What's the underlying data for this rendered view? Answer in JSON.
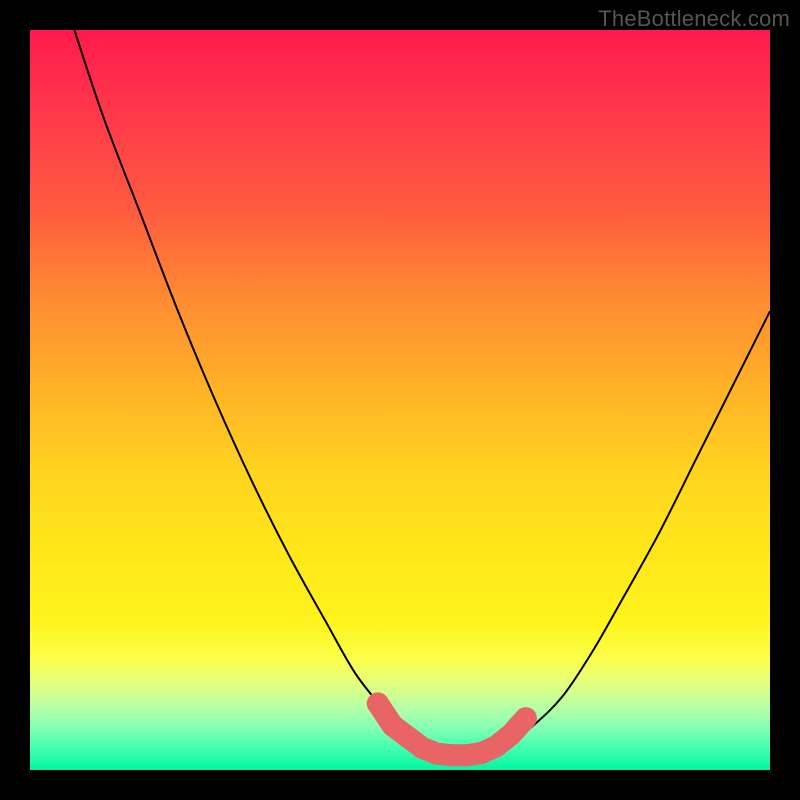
{
  "watermark": "TheBottleneck.com",
  "chart_data": {
    "type": "line",
    "title": "",
    "xlabel": "",
    "ylabel": "",
    "xlim": [
      0,
      100
    ],
    "ylim": [
      0,
      100
    ],
    "grid": false,
    "legend": false,
    "series": [
      {
        "name": "bottleneck-curve",
        "x": [
          6,
          10,
          15,
          20,
          25,
          30,
          35,
          40,
          44,
          48,
          51,
          54,
          58,
          60,
          64,
          68,
          72,
          76,
          80,
          85,
          90,
          95,
          100
        ],
        "y": [
          100,
          88,
          75,
          62,
          50,
          39,
          29,
          20,
          13,
          8,
          5,
          3,
          2,
          2,
          3,
          6,
          10,
          16,
          23,
          32,
          42,
          52,
          62
        ]
      }
    ],
    "highlight_points": {
      "name": "optimal-range-markers",
      "x": [
        47,
        49,
        51,
        53,
        55,
        57,
        59,
        61,
        63,
        65,
        67
      ],
      "y": [
        9,
        6,
        4.5,
        3,
        2.2,
        2,
        2,
        2.3,
        3.2,
        4.8,
        7
      ]
    },
    "gradient_stops": [
      {
        "pos": 0,
        "color": "#ff1a4d"
      },
      {
        "pos": 12,
        "color": "#ff3a4a"
      },
      {
        "pos": 24,
        "color": "#ff5a3f"
      },
      {
        "pos": 36,
        "color": "#ff8a33"
      },
      {
        "pos": 48,
        "color": "#ffb028"
      },
      {
        "pos": 60,
        "color": "#ffd41f"
      },
      {
        "pos": 70,
        "color": "#ffe61a"
      },
      {
        "pos": 80,
        "color": "#fff41c"
      },
      {
        "pos": 85,
        "color": "#fbff4a"
      },
      {
        "pos": 88,
        "color": "#e6ff7a"
      },
      {
        "pos": 91,
        "color": "#bfffa0"
      },
      {
        "pos": 94,
        "color": "#8affb3"
      },
      {
        "pos": 97,
        "color": "#44ffb2"
      },
      {
        "pos": 100,
        "color": "#00f7a0"
      }
    ]
  }
}
